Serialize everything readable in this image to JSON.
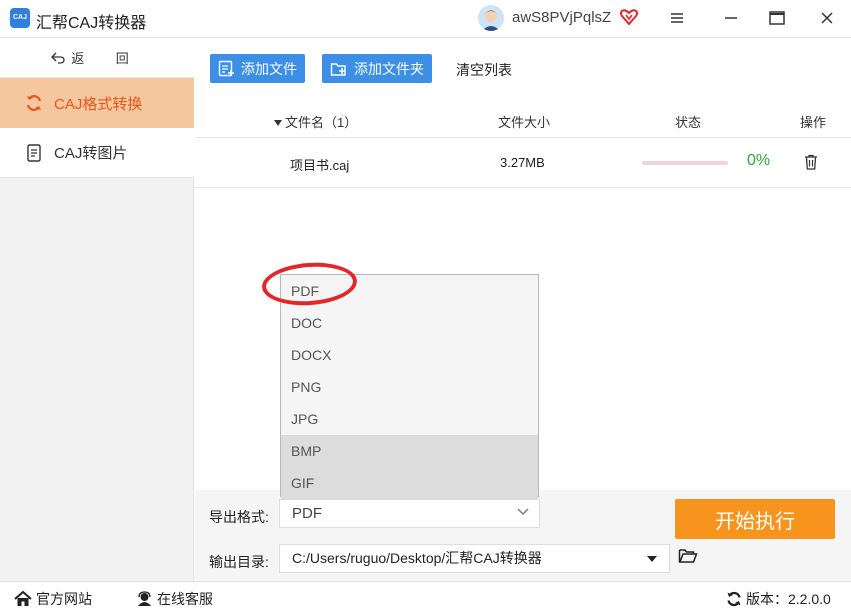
{
  "app": {
    "title": "汇帮CAJ转换器",
    "icon_text": "CAJ"
  },
  "user": {
    "name": "awS8PVjPqlsZ"
  },
  "sidebar": {
    "back_label": "返 回",
    "items": [
      {
        "label": "CAJ格式转换",
        "icon": "refresh-icon",
        "active": true
      },
      {
        "label": "CAJ转图片",
        "icon": "document-icon",
        "active": false
      }
    ]
  },
  "toolbar": {
    "add_file": "添加文件",
    "add_folder": "添加文件夹",
    "clear_list": "清空列表"
  },
  "table": {
    "headers": {
      "name": "文件名（1）",
      "size": "文件大小",
      "status": "状态",
      "action": "操作"
    },
    "rows": [
      {
        "name": "项目书.caj",
        "size": "3.27MB",
        "progress": 0,
        "progress_text": "0%"
      }
    ]
  },
  "format_dropdown": {
    "options": [
      "PDF",
      "DOC",
      "DOCX",
      "PNG",
      "JPG",
      "BMP",
      "GIF"
    ],
    "highlighted": [
      "BMP",
      "GIF"
    ]
  },
  "settings": {
    "format_label": "导出格式:",
    "format_value": "PDF",
    "dir_label": "输出目录:",
    "dir_value": "C:/Users/ruguo/Desktop/汇帮CAJ转换器"
  },
  "start_button": "开始执行",
  "statusbar": {
    "website": "官方网站",
    "support": "在线客服",
    "version": "版本：2.2.0.0"
  },
  "colors": {
    "accent_blue": "#3d8fe6",
    "active_nav_bg": "#f5c79e",
    "active_nav_text": "#e8561a",
    "start_orange": "#f7941d",
    "progress_green": "#2ea63a",
    "annotation_red": "#e3262a"
  }
}
